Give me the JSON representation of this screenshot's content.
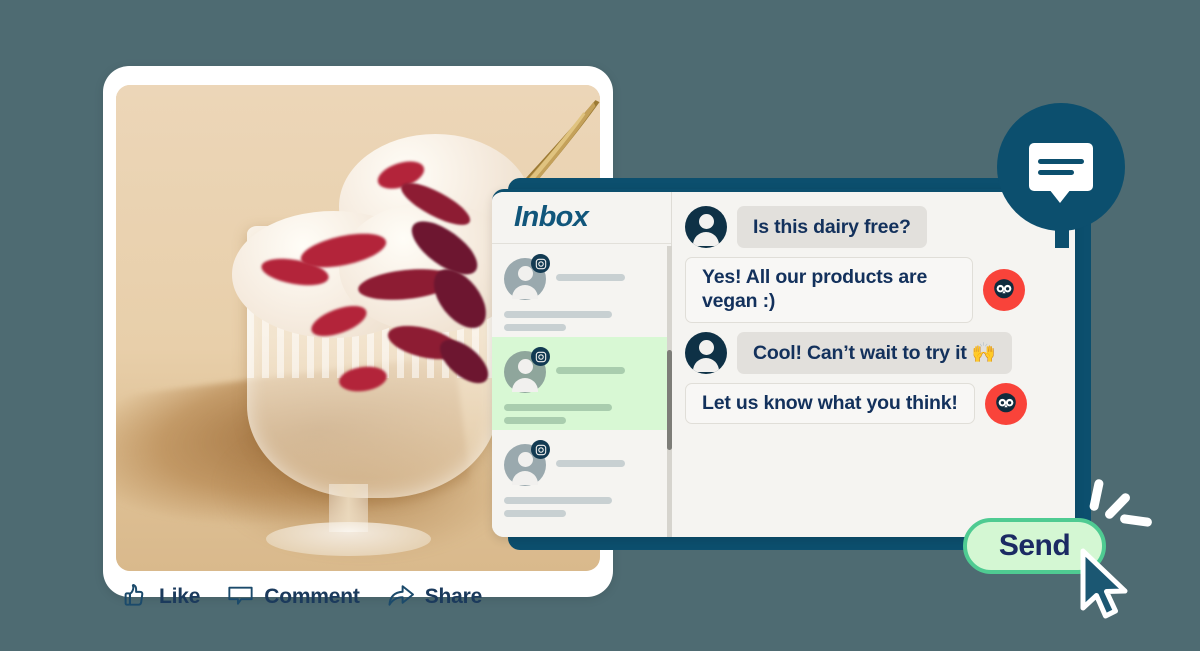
{
  "theme": {
    "background": "#4e6b72",
    "dark_teal": "#0c4f6e",
    "navy_text": "#13315c",
    "brand_red": "#f9433a",
    "accent_green_fill": "#d4f7d3",
    "accent_green_border": "#4fcb92",
    "highlight_green": "#d8f8d4",
    "card_white": "#ffffff",
    "panel_bg": "#f5f4f1"
  },
  "social_post": {
    "image_alt": "ice-cream-sundae-photo",
    "actions": [
      {
        "label": "Like",
        "icon": "thumbs-up-icon"
      },
      {
        "label": "Comment",
        "icon": "comment-bubble-icon"
      },
      {
        "label": "Share",
        "icon": "share-arrow-icon"
      }
    ]
  },
  "inbox": {
    "title": "Inbox",
    "conversations": [
      {
        "id": 1,
        "platform_icon": "instagram-icon",
        "avatar": "user-avatar",
        "active": false
      },
      {
        "id": 2,
        "platform_icon": "instagram-icon",
        "avatar": "user-avatar",
        "active": true
      },
      {
        "id": 3,
        "platform_icon": "instagram-icon",
        "avatar": "user-avatar",
        "active": false
      }
    ],
    "scrollbar": {
      "visible": true
    }
  },
  "chat": {
    "messages": [
      {
        "id": 1,
        "from": "customer",
        "avatar": "user-avatar",
        "text": "Is this dairy free?"
      },
      {
        "id": 2,
        "from": "brand",
        "avatar": "hootsuite-owl-icon",
        "text": "Yes! All our products are vegan :)"
      },
      {
        "id": 3,
        "from": "customer",
        "avatar": "user-avatar",
        "text": "Cool! Can’t wait to try it 🙌"
      },
      {
        "id": 4,
        "from": "brand",
        "avatar": "hootsuite-owl-icon",
        "text": "Let us know what you think!"
      }
    ]
  },
  "badge": {
    "icon": "chat-bubble-icon"
  },
  "send": {
    "label": "Send",
    "cursor": "mouse-pointer-icon",
    "click_effect": "click-burst"
  }
}
